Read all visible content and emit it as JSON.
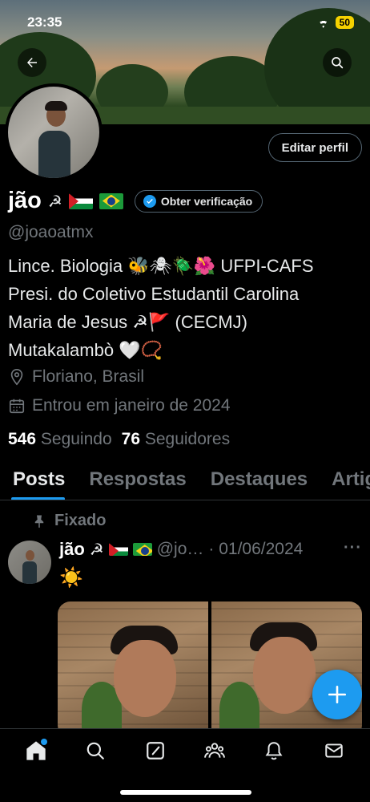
{
  "status_bar": {
    "time": "23:35",
    "battery": "50"
  },
  "header": {
    "display_name": "jão",
    "name_emoji": "☭",
    "verify_label": "Obter verificação",
    "handle": "@joaoatmx",
    "edit_label": "Editar perfil"
  },
  "bio": {
    "line1": "Lince. Biologia 🐝🕷🪲🌺 UFPI-CAFS",
    "line2": "Presi. do Coletivo Estudantil Carolina",
    "line3": "Maria de Jesus ☭🚩 (CECMJ)",
    "line4": "Mutakalambò 🤍📿"
  },
  "meta": {
    "location": "Floriano, Brasil",
    "joined": "Entrou em janeiro de 2024"
  },
  "stats": {
    "following_count": "546",
    "following_label": "Seguindo",
    "followers_count": "76",
    "followers_label": "Seguidores"
  },
  "tabs": [
    "Posts",
    "Respostas",
    "Destaques",
    "Artigos"
  ],
  "post": {
    "pinned_label": "Fixado",
    "author": "jão",
    "author_emoji": "☭",
    "handle": "@jo…",
    "date": "· 01/06/2024",
    "more": "···",
    "text": "☀️"
  },
  "icons": {
    "back": "arrow-left-icon",
    "search": "search-icon",
    "location": "location-pin-icon",
    "calendar": "calendar-icon",
    "pin": "pin-icon",
    "compose": "plus-icon"
  },
  "colors": {
    "accent": "#1d9bf0",
    "background": "#000000",
    "muted": "#71767b",
    "battery": "#f5d200"
  }
}
